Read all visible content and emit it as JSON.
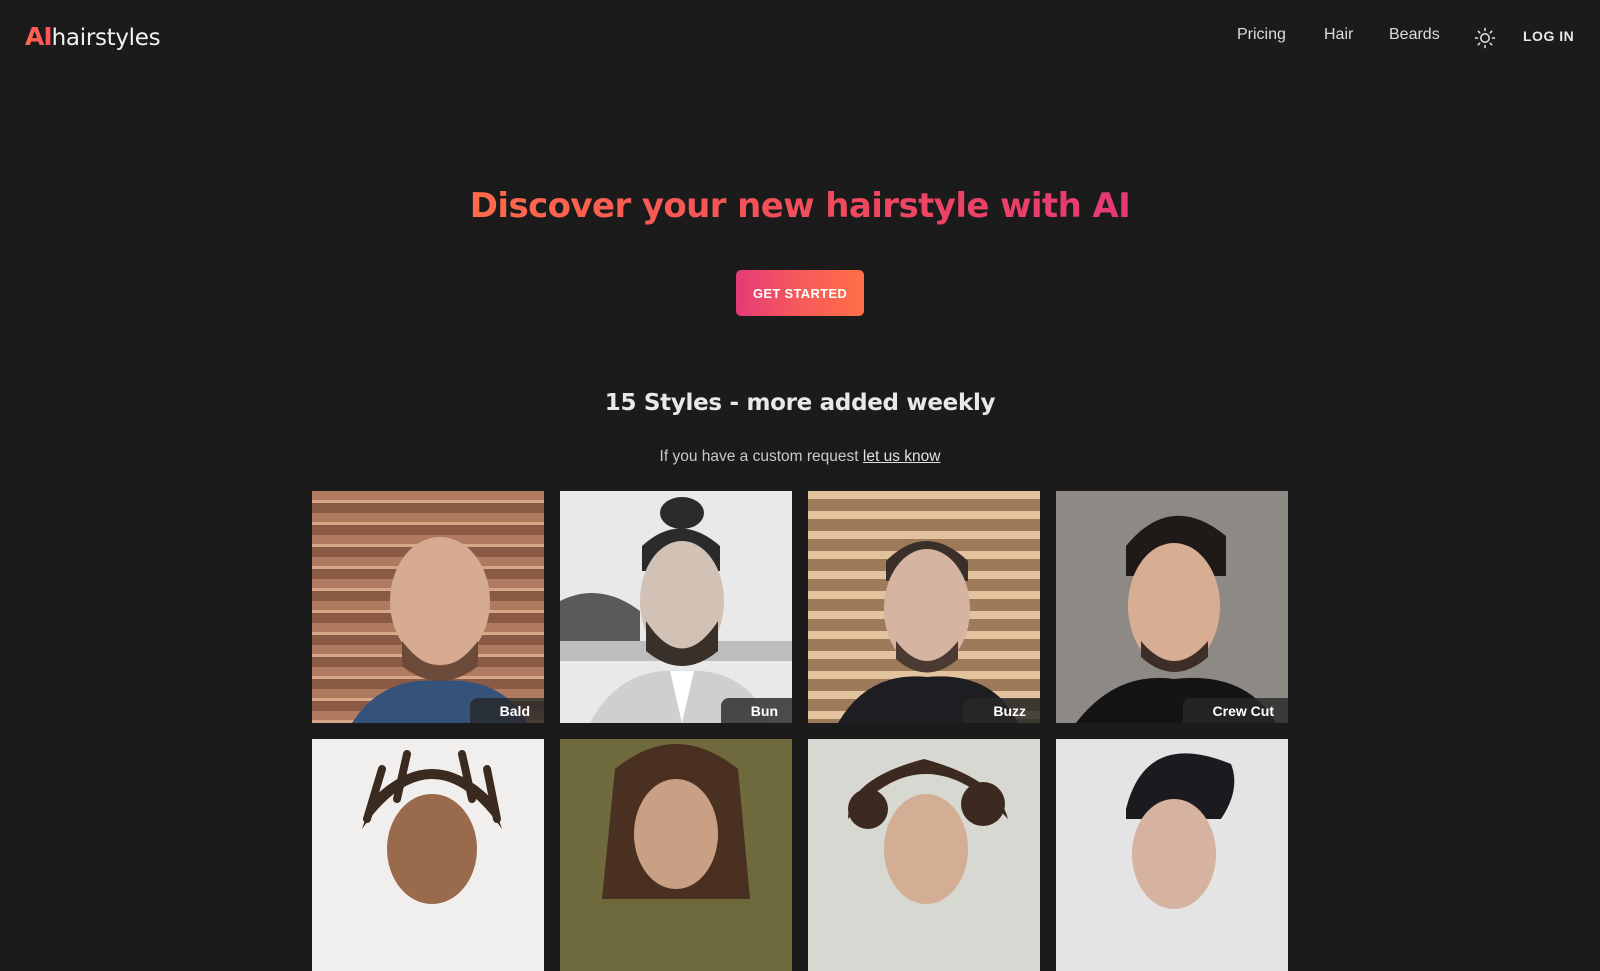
{
  "header": {
    "logo": {
      "ai": "AI",
      "rest": "hairstyles"
    },
    "nav": [
      {
        "label": "Pricing"
      },
      {
        "label": "Hair"
      },
      {
        "label": "Beards"
      }
    ],
    "theme_icon": "sun-icon",
    "login_label": "LOG IN"
  },
  "hero": {
    "title": "Discover your new hairstyle with AI",
    "cta_label": "GET STARTED"
  },
  "styles": {
    "heading": "15 Styles - more added weekly",
    "custom_prefix": "If you have a custom request",
    "custom_link": "let us know",
    "items": [
      {
        "label": "Bald"
      },
      {
        "label": "Bun"
      },
      {
        "label": "Buzz"
      },
      {
        "label": "Crew Cut"
      },
      {
        "label": ""
      },
      {
        "label": ""
      },
      {
        "label": ""
      },
      {
        "label": ""
      }
    ]
  },
  "colors": {
    "background": "#1b1b1c",
    "accent_start": "#ff6b4a",
    "accent_end": "#e43a73"
  }
}
